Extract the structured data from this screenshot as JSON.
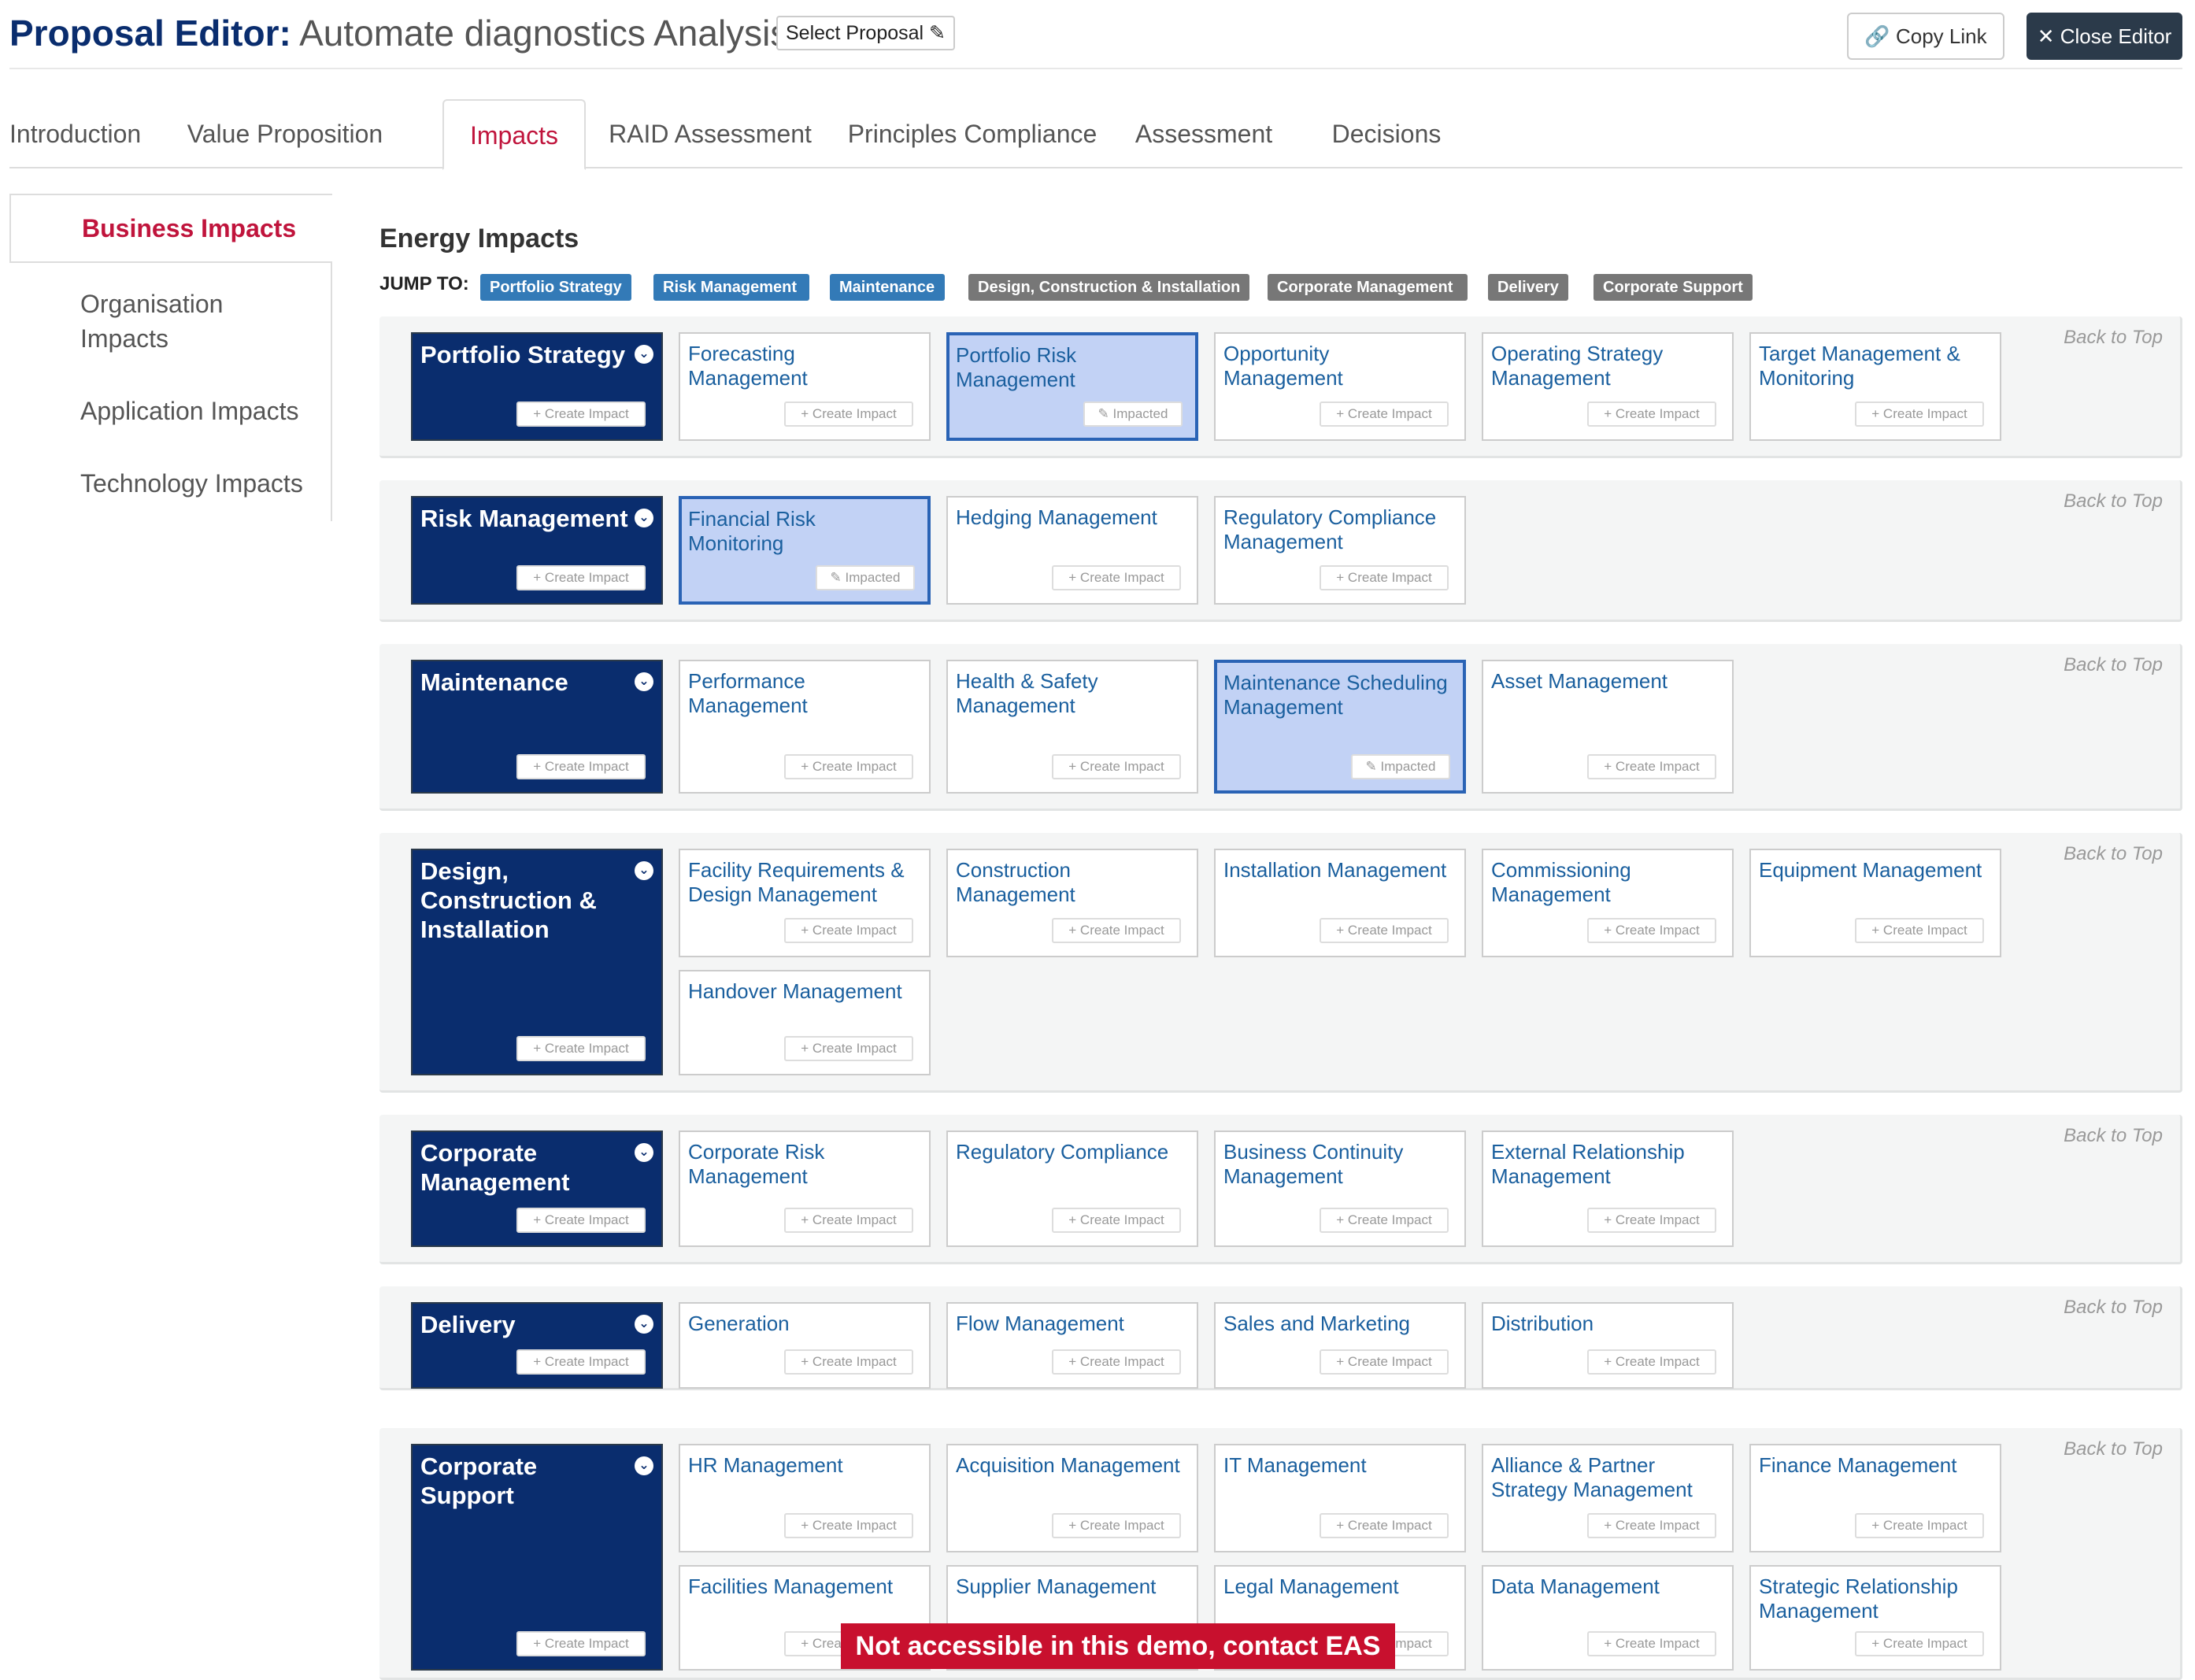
{
  "header": {
    "title_prefix": "Proposal Editor:",
    "title_name": "Automate diagnostics Analysis",
    "select_proposal": "Select Proposal ✎",
    "copy_link": "🔗 Copy Link",
    "close_editor": "✕ Close Editor"
  },
  "tabs": [
    {
      "label": "Introduction",
      "active": false
    },
    {
      "label": "Value Proposition",
      "active": false
    },
    {
      "label": "Impacts",
      "active": true
    },
    {
      "label": "RAID Assessment",
      "active": false
    },
    {
      "label": "Principles Compliance",
      "active": false
    },
    {
      "label": "Assessment",
      "active": false
    },
    {
      "label": "Decisions",
      "active": false
    }
  ],
  "sidenav": [
    {
      "label": "Business Impacts",
      "active": true
    },
    {
      "label": "Organisation Impacts",
      "active": false
    },
    {
      "label": "Application Impacts",
      "active": false
    },
    {
      "label": "Technology Impacts",
      "active": false
    }
  ],
  "section": {
    "title": "Energy Impacts",
    "jump_label": "JUMP TO:"
  },
  "jump_tags": [
    {
      "label": "Portfolio Strategy",
      "color": "#337ab7"
    },
    {
      "label": "Risk Management",
      "color": "#337ab7"
    },
    {
      "label": "Maintenance",
      "color": "#337ab7"
    },
    {
      "label": "Design, Construction & Installation",
      "color": "#777777"
    },
    {
      "label": "Corporate Management",
      "color": "#777777"
    },
    {
      "label": "Delivery",
      "color": "#777777"
    },
    {
      "label": "Corporate Support",
      "color": "#777777"
    }
  ],
  "labels": {
    "create_impact": "+ Create Impact",
    "impacted": "✎ Impacted",
    "back_to_top": "Back to Top"
  },
  "groups": [
    {
      "title": "Portfolio Strategy",
      "capabilities": [
        {
          "label": "Forecasting Management",
          "impacted": false
        },
        {
          "label": "Portfolio Risk Management",
          "impacted": true
        },
        {
          "label": "Opportunity Management",
          "impacted": false
        },
        {
          "label": "Operating Strategy Management",
          "impacted": false
        },
        {
          "label": "Target Management & Monitoring",
          "impacted": false
        }
      ]
    },
    {
      "title": "Risk Management",
      "capabilities": [
        {
          "label": "Financial Risk Monitoring",
          "impacted": true
        },
        {
          "label": "Hedging Management",
          "impacted": false
        },
        {
          "label": "Regulatory Compliance Management",
          "impacted": false
        }
      ]
    },
    {
      "title": "Maintenance",
      "capabilities": [
        {
          "label": "Performance Management",
          "impacted": false
        },
        {
          "label": "Health & Safety Management",
          "impacted": false
        },
        {
          "label": "Maintenance Scheduling Management",
          "impacted": true
        },
        {
          "label": "Asset Management",
          "impacted": false
        }
      ]
    },
    {
      "title": "Design, Construction & Installation",
      "capabilities": [
        {
          "label": "Facility Requirements & Design Management",
          "impacted": false
        },
        {
          "label": "Construction Management",
          "impacted": false
        },
        {
          "label": "Installation Management",
          "impacted": false
        },
        {
          "label": "Commissioning Management",
          "impacted": false
        },
        {
          "label": "Equipment Management",
          "impacted": false
        },
        {
          "label": "Handover Management",
          "impacted": false
        }
      ]
    },
    {
      "title": "Corporate Management",
      "capabilities": [
        {
          "label": "Corporate Risk Management",
          "impacted": false
        },
        {
          "label": "Regulatory Compliance",
          "impacted": false
        },
        {
          "label": "Business Continuity Management",
          "impacted": false
        },
        {
          "label": "External Relationship Management",
          "impacted": false
        }
      ]
    },
    {
      "title": "Delivery",
      "capabilities": [
        {
          "label": "Generation",
          "impacted": false
        },
        {
          "label": "Flow Management",
          "impacted": false
        },
        {
          "label": "Sales and Marketing",
          "impacted": false
        },
        {
          "label": "Distribution",
          "impacted": false
        }
      ]
    },
    {
      "title": "Corporate Support",
      "capabilities": [
        {
          "label": "HR Management",
          "impacted": false
        },
        {
          "label": "Acquisition Management",
          "impacted": false
        },
        {
          "label": "IT Management",
          "impacted": false
        },
        {
          "label": "Alliance & Partner Strategy Management",
          "impacted": false
        },
        {
          "label": "Finance Management",
          "impacted": false
        },
        {
          "label": "Facilities Management",
          "impacted": false
        },
        {
          "label": "Supplier Management",
          "impacted": false
        },
        {
          "label": "Legal Management",
          "impacted": false
        },
        {
          "label": "Data Management",
          "impacted": false
        },
        {
          "label": "Strategic Relationship Management",
          "impacted": false
        }
      ]
    }
  ],
  "banner": "Not accessible in this demo, contact EAS",
  "colors": {
    "brand_navy": "#0a2d6e",
    "accent_red": "#c0143c",
    "link_blue": "#1a5f9e",
    "impacted_fill": "#c2d2f5",
    "impacted_border": "#2a63b5"
  }
}
